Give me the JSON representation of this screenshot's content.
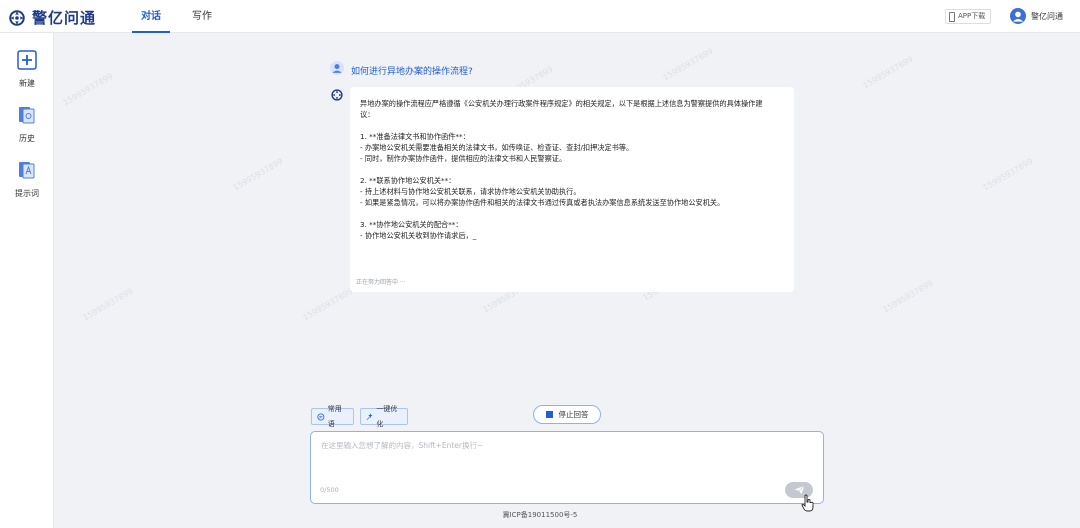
{
  "brand": {
    "name": "警亿问通"
  },
  "tabs": [
    {
      "label": "对话",
      "active": true
    },
    {
      "label": "写作",
      "active": false
    }
  ],
  "header": {
    "app_download": "APP下载",
    "user_name": "警亿问通"
  },
  "sidebar": {
    "items": [
      {
        "label": "新建",
        "icon": "plus-square-icon"
      },
      {
        "label": "历史",
        "icon": "history-book-icon"
      },
      {
        "label": "提示词",
        "icon": "prompt-card-icon"
      }
    ]
  },
  "watermark": "15995937899",
  "chat": {
    "question": "如何进行异地办案的操作流程?",
    "answer_lines": [
      "异地办案的操作流程应严格遵循《公安机关办理行政案件程序规定》的相关规定，以下是根据上述信息为警察提供的具体操作建",
      "议：",
      "",
      "1. **准备法律文书和协作函件**：",
      "- 办案地公安机关需要准备相关的法律文书，如传唤证、检查证、查封/扣押决定书等。",
      "- 同时，制作办案协作函件，提供相应的法律文书和人民警察证。",
      "",
      "2. **联系协作地公安机关**：",
      "- 持上述材料与协作地公安机关联系，请求协作地公安机关协助执行。",
      "- 如果是紧急情况，可以将办案协作函件和相关的法律文书通过传真或者执法办案信息系统发送至协作地公安机关。",
      "",
      "3. **协作地公安机关的配合**：",
      "- 协作地公安机关收到协作请求后，_"
    ],
    "status": "正在努力回答中 ···"
  },
  "input": {
    "chip_common": "常用语",
    "chip_optimize": "一键优化",
    "stop_label": "停止回答",
    "placeholder": "在这里输入您想了解的内容，Shift+Enter换行~",
    "counter": "0/500",
    "value": ""
  },
  "footer": {
    "icp": "冀ICP备19011500号-5"
  },
  "colors": {
    "accent": "#1f5ed8",
    "brand": "#1e3a8a",
    "background": "#f0f2f5"
  }
}
